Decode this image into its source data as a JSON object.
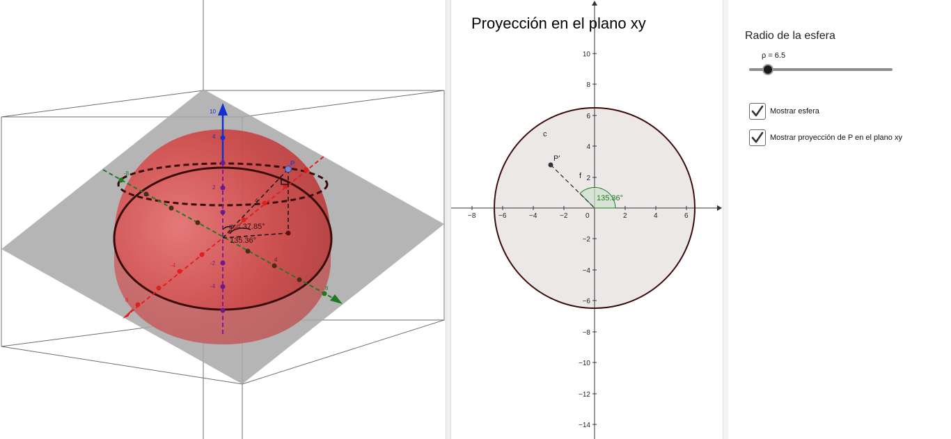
{
  "view3d": {
    "point_label": "P",
    "angle_phi_label": "φ = 37.85°",
    "angle_theta_label": "135.36°",
    "axis_ticks_z": [
      "10",
      "4",
      "2",
      "-2",
      "-4"
    ],
    "axis_ticks_xy": [
      "8",
      "6",
      "4",
      "2",
      "-2",
      "-4",
      "-6",
      "-8"
    ],
    "colors": {
      "sphere": "#d23a3a",
      "x_axis": "#e02020",
      "y_axis": "#1f7a1f",
      "z_axis": "#1030d0",
      "plane": "#9e9e9e"
    }
  },
  "view2d": {
    "title": "Proyección en el plano xy",
    "x_ticks": [
      "−8",
      "−6",
      "−4",
      "−2",
      "0",
      "2",
      "4",
      "6"
    ],
    "y_ticks": [
      "10",
      "8",
      "6",
      "4",
      "2",
      "−2",
      "−4",
      "−6",
      "−8",
      "−10",
      "−12",
      "−14"
    ],
    "circle_label": "c",
    "point_label": "P'",
    "segment_label": "f",
    "angle_label": "135.36°",
    "colors": {
      "circle_stroke": "#3a0a0a",
      "circle_fill": "#ebe6e6",
      "angle": "#1e7a1e"
    }
  },
  "controls": {
    "title": "Radio de la esfera",
    "slider": {
      "label": "ρ = 6.5",
      "value": 6.5
    },
    "checkboxes": [
      {
        "label": "Mostrar esfera",
        "checked": true
      },
      {
        "label": "Mostrar proyección de P en el plano xy",
        "checked": true
      }
    ]
  }
}
